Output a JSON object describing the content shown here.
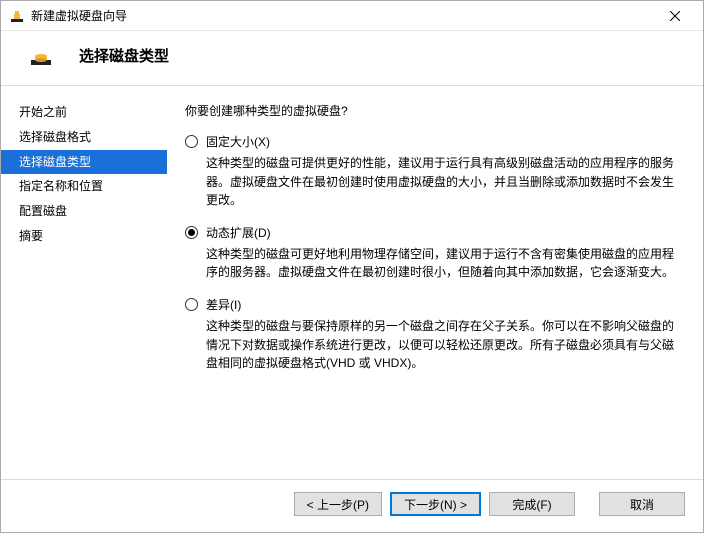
{
  "window": {
    "title": "新建虚拟硬盘向导"
  },
  "header": {
    "title": "选择磁盘类型"
  },
  "sidebar": {
    "items": [
      {
        "label": "开始之前"
      },
      {
        "label": "选择磁盘格式"
      },
      {
        "label": "选择磁盘类型"
      },
      {
        "label": "指定名称和位置"
      },
      {
        "label": "配置磁盘"
      },
      {
        "label": "摘要"
      }
    ],
    "activeIndex": 2
  },
  "main": {
    "prompt": "你要创建哪种类型的虚拟硬盘?",
    "options": [
      {
        "label": "固定大小(X)",
        "desc": "这种类型的磁盘可提供更好的性能，建议用于运行具有高级别磁盘活动的应用程序的服务器。虚拟硬盘文件在最初创建时使用虚拟硬盘的大小，并且当删除或添加数据时不会发生更改。",
        "checked": false
      },
      {
        "label": "动态扩展(D)",
        "desc": "这种类型的磁盘可更好地利用物理存储空间，建议用于运行不含有密集使用磁盘的应用程序的服务器。虚拟硬盘文件在最初创建时很小，但随着向其中添加数据，它会逐渐变大。",
        "checked": true
      },
      {
        "label": "差异(I)",
        "desc": "这种类型的磁盘与要保持原样的另一个磁盘之间存在父子关系。你可以在不影响父磁盘的情况下对数据或操作系统进行更改，以便可以轻松还原更改。所有子磁盘必须具有与父磁盘相同的虚拟硬盘格式(VHD 或 VHDX)。",
        "checked": false
      }
    ]
  },
  "footer": {
    "prev": "< 上一步(P)",
    "next": "下一步(N) >",
    "finish": "完成(F)",
    "cancel": "取消"
  }
}
